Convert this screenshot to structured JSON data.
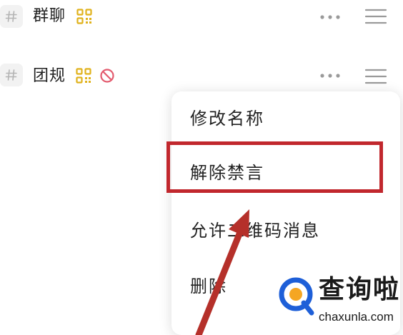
{
  "channels": [
    {
      "name": "群聊",
      "has_qr": true,
      "muted": false,
      "icons": [
        "hash-icon",
        "qr-code-icon",
        "more-icon",
        "drag-handle-icon"
      ]
    },
    {
      "name": "团规",
      "has_qr": true,
      "muted": true,
      "icons": [
        "hash-icon",
        "qr-code-icon",
        "ban-icon",
        "more-icon",
        "drag-handle-icon"
      ]
    }
  ],
  "context_menu": {
    "items": [
      {
        "label": "修改名称"
      },
      {
        "label": "解除禁言",
        "highlighted": true
      },
      {
        "label": "允许二维码消息"
      },
      {
        "label": "删除"
      }
    ]
  },
  "watermark": {
    "name": "查询啦",
    "url": "chaxunla.com"
  },
  "colors": {
    "qr_icon": "#e0b21c",
    "ban_icon": "#e35b6e",
    "highlight_box": "#c1272d",
    "arrow": "#b5302a",
    "watermark_blue": "#1e5fd8",
    "watermark_orange": "#f5a623"
  }
}
